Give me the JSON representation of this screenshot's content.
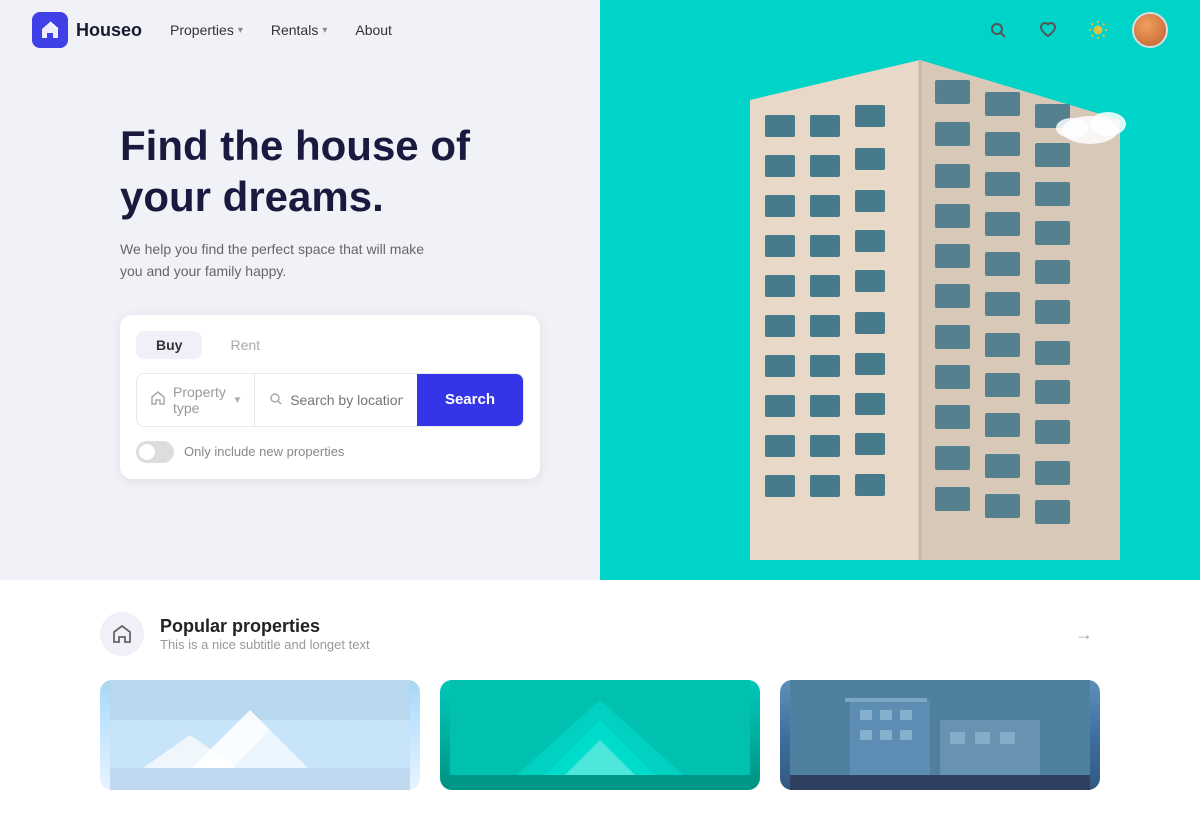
{
  "nav": {
    "logo_text": "Houseo",
    "links": [
      {
        "label": "Properties",
        "has_dropdown": true
      },
      {
        "label": "Rentals",
        "has_dropdown": true
      },
      {
        "label": "About",
        "has_dropdown": false
      }
    ],
    "icons": [
      "search",
      "heart",
      "sun",
      "avatar"
    ]
  },
  "hero": {
    "title": "Find the house of your dreams.",
    "subtitle": "We help you find the perfect space that will make you and your family happy.",
    "tabs": [
      "Buy",
      "Rent"
    ],
    "active_tab": "Buy",
    "search": {
      "property_type_label": "Property type",
      "location_placeholder": "Search by location",
      "search_button": "Search"
    },
    "toggle_label": "Only include new properties"
  },
  "popular": {
    "title": "Popular properties",
    "subtitle": "This is a nice subtitle and longet text",
    "cards": [
      {
        "id": 1,
        "bg": "light-blue"
      },
      {
        "id": 2,
        "bg": "teal"
      },
      {
        "id": 3,
        "bg": "dark-blue"
      }
    ]
  }
}
